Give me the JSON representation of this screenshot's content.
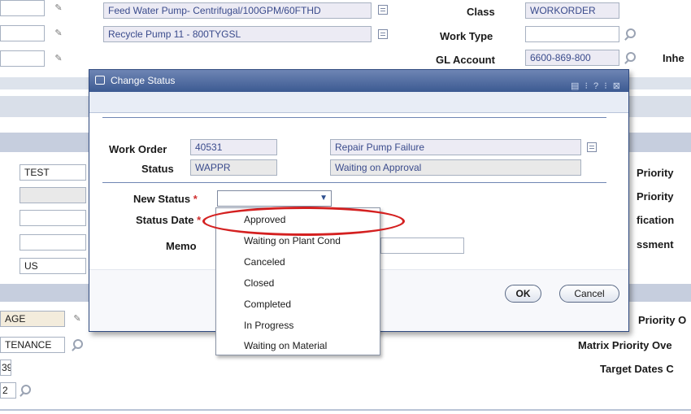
{
  "background": {
    "asset_desc_1": "Feed Water Pump- Centrifugal/100GPM/60FTHD",
    "asset_desc_2": "Recycle Pump 11 - 800TYGSL",
    "class_label": "Class",
    "class_value": "WORKORDER",
    "work_type_label": "Work Type",
    "work_type_value": "",
    "gl_account_label": "GL Account",
    "gl_account_value": "6600-869-800",
    "inherit_label": "Inhe",
    "left_fields": [
      "TEST",
      "",
      "",
      "",
      "US"
    ],
    "right_labels_1": [
      "Priority",
      "Priority",
      "fication",
      "ssment"
    ],
    "bottom_left_fields": [
      "AGE",
      "TENANCE",
      "39",
      "2"
    ],
    "bottom_right_labels": [
      "Priority O",
      "Matrix Priority Ove",
      "Target Dates C"
    ]
  },
  "dialog": {
    "title": "Change Status",
    "toolbar_glyphs": "▤ ⁝ ? ⁝ ⊠",
    "work_order_label": "Work Order",
    "work_order_value": "40531",
    "work_order_desc": "Repair Pump Failure",
    "status_label": "Status",
    "status_value": "WAPPR",
    "status_desc": "Waiting on Approval",
    "new_status_label": "New Status",
    "new_status_value": "",
    "status_date_label": "Status Date",
    "memo_label": "Memo",
    "memo_value": "",
    "ok_label": "OK",
    "cancel_label": "Cancel",
    "required_marker": "*"
  },
  "dropdown": {
    "options": [
      "Approved",
      "Waiting on Plant Cond",
      "Canceled",
      "Closed",
      "Completed",
      "In Progress",
      "Waiting on Material"
    ],
    "highlighted": "Approved",
    "highlight_color": "#d42020"
  }
}
